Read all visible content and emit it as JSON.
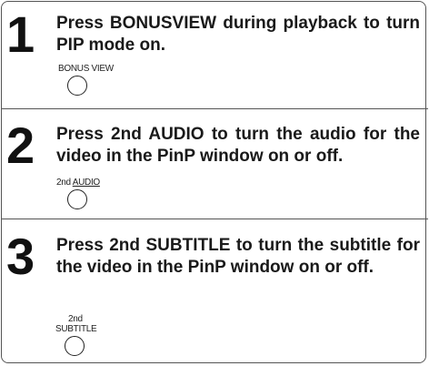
{
  "steps": [
    {
      "number": "1",
      "instruction": "Press BONUSVIEW during playback to turn PIP mode on.",
      "button_label": "BONUS VIEW"
    },
    {
      "number": "2",
      "instruction": "Press 2nd AUDIO to turn the audio for the video in the PinP window on or off.",
      "button_label_prefix": "2nd",
      "button_label_main": "AUDIO"
    },
    {
      "number": "3",
      "instruction": "Press 2nd SUBTITLE to turn the subtitle for the video in the PinP window on or off.",
      "button_label_top": "2nd",
      "button_label_main": "SUBTITLE"
    }
  ]
}
